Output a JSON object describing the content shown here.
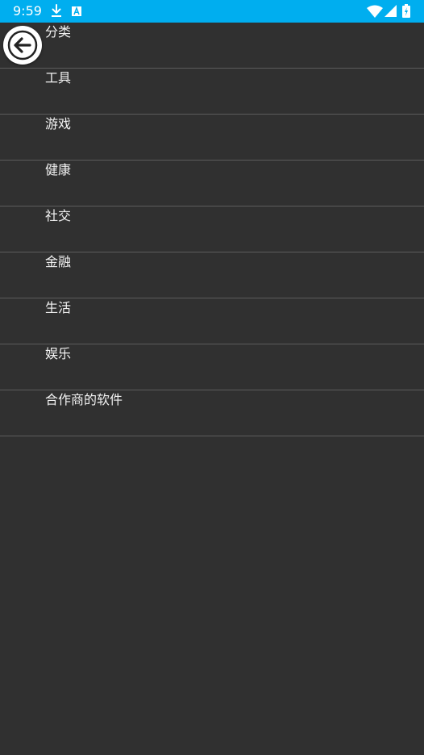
{
  "status_bar": {
    "time": "9:59",
    "background": "#00aeef",
    "icons": [
      "download-icon",
      "text-a-icon",
      "wifi-icon",
      "signal-icon",
      "battery-charging-icon"
    ]
  },
  "back_button": {
    "icon": "arrow-left-icon"
  },
  "category_list": {
    "items": [
      {
        "label": "分类"
      },
      {
        "label": "工具"
      },
      {
        "label": "游戏"
      },
      {
        "label": "健康"
      },
      {
        "label": "社交"
      },
      {
        "label": "金融"
      },
      {
        "label": "生活"
      },
      {
        "label": "娱乐"
      },
      {
        "label": "合作商的软件"
      }
    ]
  }
}
